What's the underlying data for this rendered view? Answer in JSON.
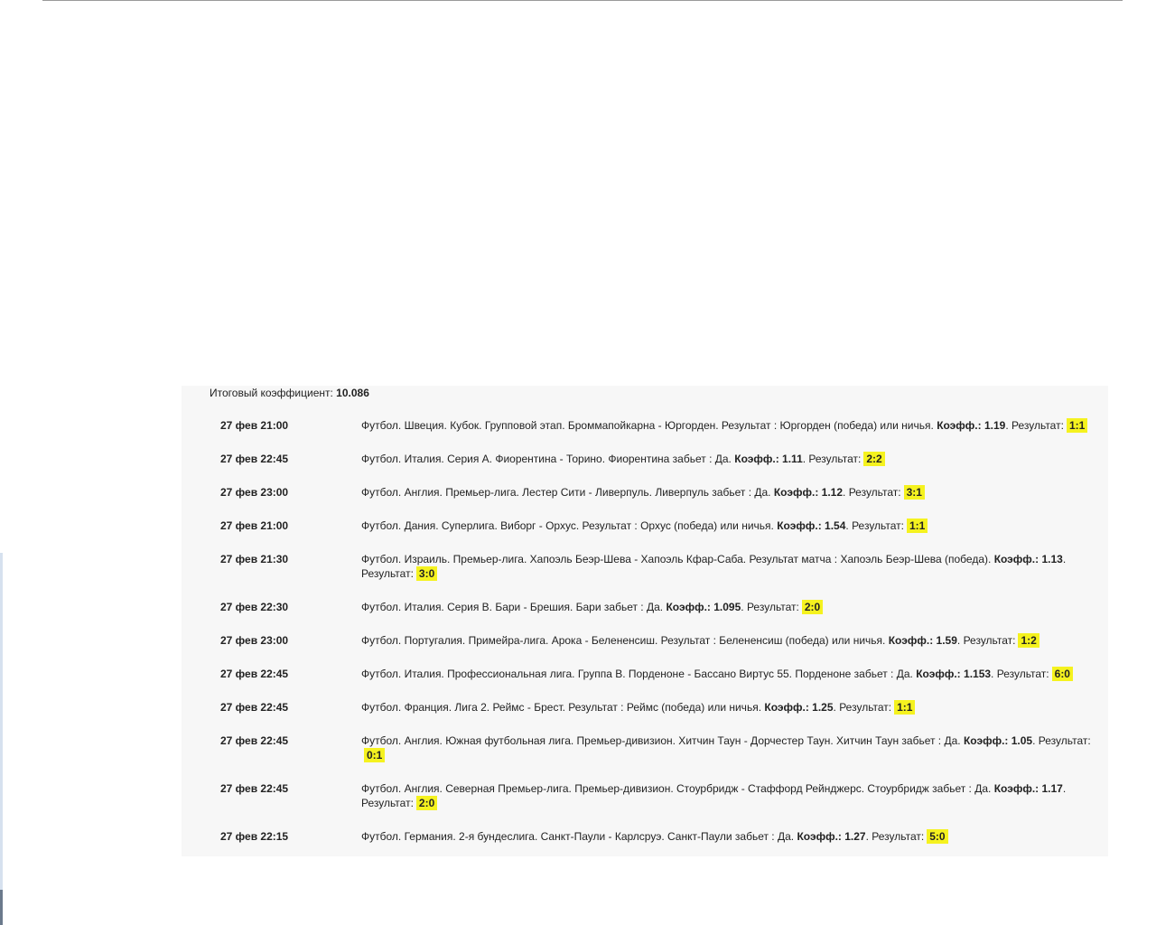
{
  "total": {
    "label": "Итоговый коэффициент:",
    "value": "10.086"
  },
  "labels": {
    "coef": "Коэфф.:",
    "result": "Результат:"
  },
  "bets": [
    {
      "time": "27 фев 21:00",
      "desc": "Футбол. Швеция. Кубок. Групповой этап. Броммапойкарна - Юргорден. Результат : Юргорден (победа) или ничья.",
      "coef": "1.19",
      "score": "1:1"
    },
    {
      "time": "27 фев 22:45",
      "desc": "Футбол. Италия. Серия А. Фиорентина - Торино. Фиорентина забьет : Да.",
      "coef": "1.11",
      "score": "2:2"
    },
    {
      "time": "27 фев 23:00",
      "desc": "Футбол. Англия. Премьер-лига. Лестер Сити - Ливерпуль. Ливерпуль забьет : Да.",
      "coef": "1.12",
      "score": "3:1"
    },
    {
      "time": "27 фев 21:00",
      "desc": "Футбол. Дания. Суперлига. Виборг - Орхус. Результат : Орхус (победа) или ничья.",
      "coef": "1.54",
      "score": "1:1"
    },
    {
      "time": "27 фев 21:30",
      "desc": "Футбол. Израиль. Премьер-лига. Хапоэль Беэр-Шева - Хапоэль Кфар-Саба. Результат матча : Хапоэль Беэр-Шева (победа).",
      "coef": "1.13",
      "score": "3:0"
    },
    {
      "time": "27 фев 22:30",
      "desc": "Футбол. Италия. Серия B. Бари - Брешия. Бари забьет : Да.",
      "coef": "1.095",
      "score": "2:0"
    },
    {
      "time": "27 фев 23:00",
      "desc": "Футбол. Португалия. Примейра-лига. Арока - Белененсиш. Результат : Белененсиш (победа) или ничья.",
      "coef": "1.59",
      "score": "1:2"
    },
    {
      "time": "27 фев 22:45",
      "desc": "Футбол. Италия. Профессиональная лига. Группа B. Порденоне - Бассано Виртус 55. Порденоне забьет : Да.",
      "coef": "1.153",
      "score": "6:0"
    },
    {
      "time": "27 фев 22:45",
      "desc": "Футбол. Франция. Лига 2. Реймс - Брест. Результат : Реймс (победа) или ничья.",
      "coef": "1.25",
      "score": "1:1"
    },
    {
      "time": "27 фев 22:45",
      "desc": "Футбол. Англия. Южная футбольная лига. Премьер-дивизион. Хитчин Таун - Дорчестер Таун. Хитчин Таун забьет : Да.",
      "coef": "1.05",
      "score": "0:1"
    },
    {
      "time": "27 фев 22:45",
      "desc": "Футбол. Англия. Северная Премьер-лига. Премьер-дивизион. Стоурбридж - Стаффорд Рейнджерс. Стоурбридж забьет : Да.",
      "coef": "1.17",
      "score": "2:0"
    },
    {
      "time": "27 фев 22:15",
      "desc": "Футбол. Германия. 2-я бундеслига. Санкт-Паули - Карлсруэ. Санкт-Паули забьет : Да.",
      "coef": "1.27",
      "score": "5:0"
    }
  ]
}
